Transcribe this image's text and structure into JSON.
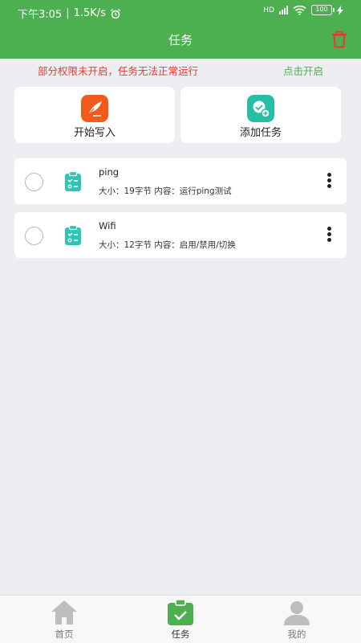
{
  "status_bar": {
    "time": "下午3:05",
    "speed": "1.5K/s",
    "network": "HD",
    "battery": "100"
  },
  "header": {
    "title": "任务"
  },
  "warning": {
    "text": "部分权限未开启，任务无法正常运行",
    "action": "点击开启"
  },
  "actions": [
    {
      "label": "开始写入",
      "icon": "quill-icon",
      "color": "#f05a1a"
    },
    {
      "label": "添加任务",
      "icon": "add-task-icon",
      "color": "#26bfa5"
    }
  ],
  "tasks": [
    {
      "name": "ping",
      "desc": "大小：19字节  内容：运行ping测试"
    },
    {
      "name": "Wifi",
      "desc": "大小：12字节  内容：启用/禁用/切换"
    }
  ],
  "bottom_nav": [
    {
      "label": "首页",
      "icon": "home-icon"
    },
    {
      "label": "任务",
      "icon": "task-icon",
      "active": true
    },
    {
      "label": "我的",
      "icon": "profile-icon"
    }
  ],
  "colors": {
    "primary": "#4caf50",
    "warning": "#e53935",
    "background": "#eceef1"
  }
}
